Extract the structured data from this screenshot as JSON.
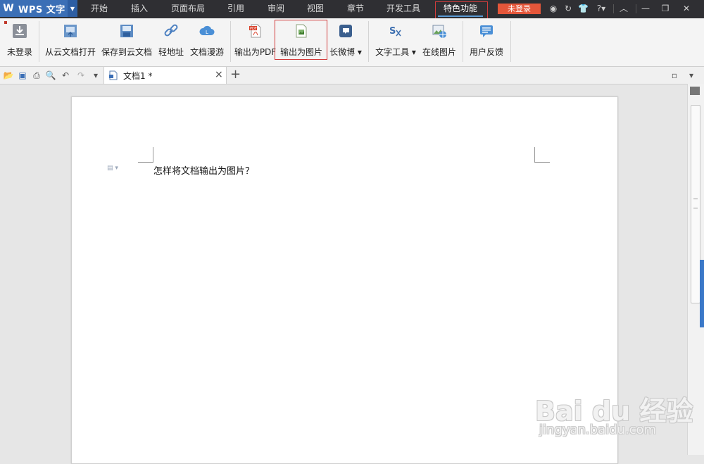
{
  "app": {
    "name": "WPS 文字",
    "logo": "W"
  },
  "menu_tabs": [
    "开始",
    "插入",
    "页面布局",
    "引用",
    "审阅",
    "视图",
    "章节",
    "开发工具",
    "特色功能"
  ],
  "active_tab": "特色功能",
  "login_button": "未登录",
  "window_controls": [
    "help-icon",
    "minimize-icon",
    "restore-icon",
    "close-icon"
  ],
  "ribbon": {
    "buttons": [
      {
        "label": "未登录",
        "icon": "download-icon"
      },
      {
        "label": "从云文档打开",
        "icon": "cloud-open-icon"
      },
      {
        "label": "保存到云文档",
        "icon": "cloud-save-icon"
      },
      {
        "label": "轻地址",
        "icon": "link-icon"
      },
      {
        "label": "文档漫游",
        "icon": "cloud-icon"
      },
      {
        "label": "输出为PDF",
        "icon": "pdf-icon"
      },
      {
        "label": "输出为图片",
        "icon": "image-export-icon"
      },
      {
        "label": "长微博",
        "icon": "weibo-icon"
      },
      {
        "label": "文字工具",
        "icon": "text-tool-icon"
      },
      {
        "label": "在线图片",
        "icon": "online-image-icon"
      },
      {
        "label": "用户反馈",
        "icon": "feedback-icon"
      }
    ]
  },
  "document_tab": {
    "title": "文档1 *",
    "close": "×",
    "new": "+"
  },
  "document": {
    "content": "怎样将文档输出为图片？"
  },
  "watermark": {
    "main": "Bai du 经验",
    "sub": "jingyan.baidu.com"
  },
  "colors": {
    "accent": "#3b6fb6",
    "highlight": "#d23c3c",
    "login": "#e5563a"
  }
}
